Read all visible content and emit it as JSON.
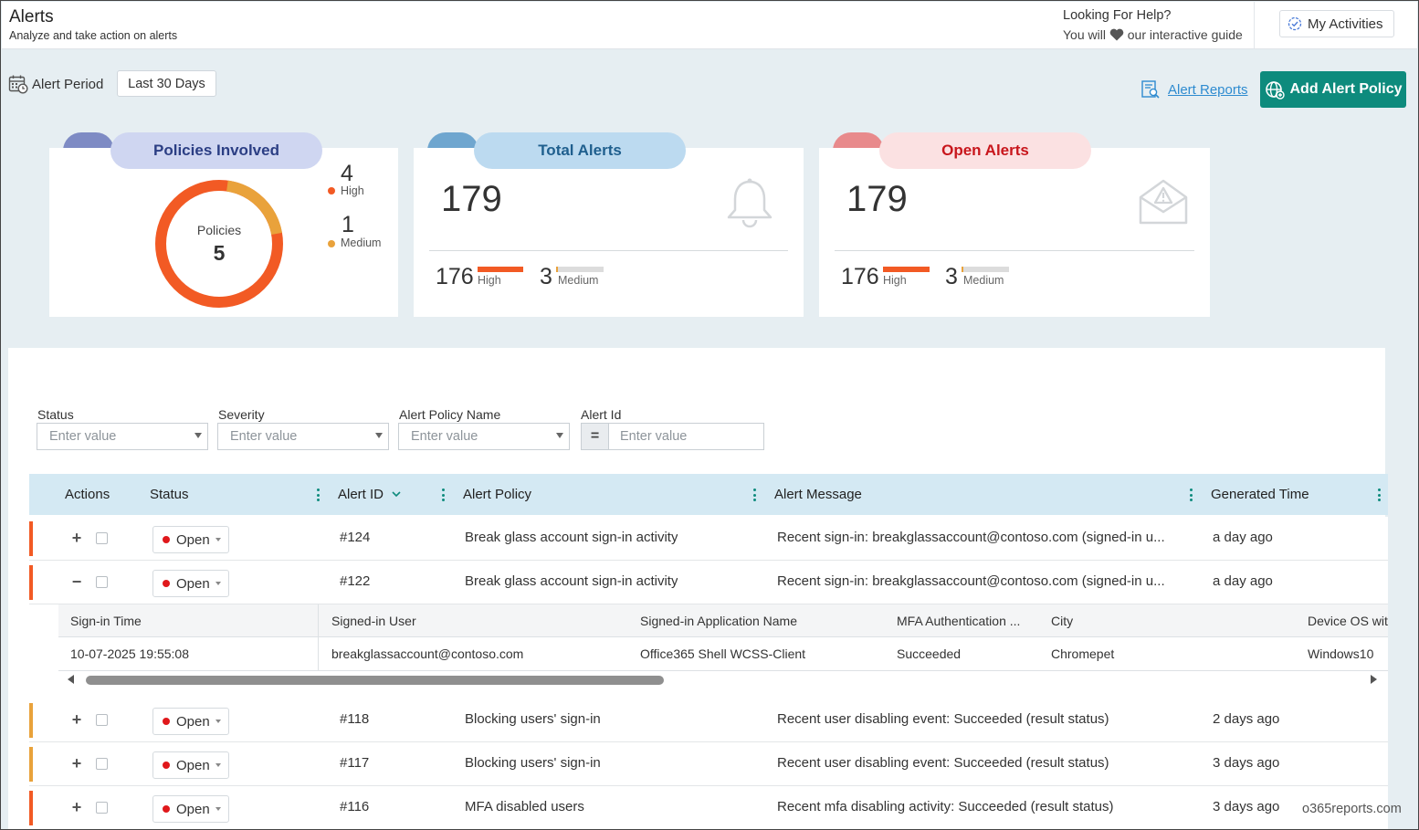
{
  "header": {
    "title": "Alerts",
    "subtitle": "Analyze and take action on alerts",
    "help_title": "Looking For Help?",
    "help_prefix": "You will",
    "help_suffix": "our interactive guide",
    "my_activities": "My Activities"
  },
  "toolbar": {
    "period_label": "Alert Period",
    "period_value": "Last 30 Days",
    "reports_link": "Alert Reports",
    "add_policy": "Add Alert Policy"
  },
  "cards": {
    "policies": {
      "title": "Policies Involved",
      "donut_label": "Policies",
      "donut_value": "5",
      "high_count": "4",
      "high_label": "High",
      "medium_count": "1",
      "medium_label": "Medium",
      "high_fraction": 0.8
    },
    "total": {
      "title": "Total Alerts",
      "value": "179",
      "high_count": "176",
      "high_label": "High",
      "medium_count": "3",
      "medium_label": "Medium"
    },
    "open": {
      "title": "Open Alerts",
      "value": "179",
      "high_count": "176",
      "high_label": "High",
      "medium_count": "3",
      "medium_label": "Medium"
    }
  },
  "filters": {
    "status_label": "Status",
    "severity_label": "Severity",
    "policy_label": "Alert Policy Name",
    "id_label": "Alert Id",
    "placeholder": "Enter value",
    "eq": "="
  },
  "table": {
    "headers": {
      "actions": "Actions",
      "status": "Status",
      "alert_id": "Alert ID",
      "policy": "Alert Policy",
      "message": "Alert Message",
      "time": "Generated Time"
    },
    "rows": [
      {
        "expander": "+",
        "status": "Open",
        "id": "#124",
        "policy": "Break glass account sign-in activity",
        "message": "Recent sign-in: breakglassaccount@contoso.com (signed-in u...",
        "time": "a day ago"
      },
      {
        "expander": "−",
        "status": "Open",
        "id": "#122",
        "policy": "Break glass account sign-in activity",
        "message": "Recent sign-in: breakglassaccount@contoso.com (signed-in u...",
        "time": "a day ago"
      },
      {
        "expander": "+",
        "status": "Open",
        "id": "#118",
        "policy": "Blocking users' sign-in",
        "message": "Recent user disabling event: Succeeded (result status)",
        "time": "2 days ago"
      },
      {
        "expander": "+",
        "status": "Open",
        "id": "#117",
        "policy": "Blocking users' sign-in",
        "message": "Recent user disabling event: Succeeded (result status)",
        "time": "3 days ago"
      },
      {
        "expander": "+",
        "status": "Open",
        "id": "#116",
        "policy": "MFA disabled users",
        "message": "Recent mfa disabling activity: Succeeded (result status)",
        "time": "3 days ago"
      }
    ]
  },
  "detail": {
    "headers": {
      "signin_time": "Sign-in Time",
      "user": "Signed-in User",
      "app": "Signed-in Application Name",
      "mfa": "MFA Authentication ...",
      "city": "City",
      "os": "Device OS with"
    },
    "values": {
      "signin_time": "10-07-2025 19:55:08",
      "user": "breakglassaccount@contoso.com",
      "app": "Office365 Shell WCSS-Client",
      "mfa": "Succeeded",
      "city": "Chromepet",
      "os": "Windows10"
    }
  },
  "watermark": "o365reports.com",
  "colors": {
    "accent": "#0e8b7d",
    "high": "#f25a24",
    "medium": "#e9a23b",
    "link": "#2e8bd0",
    "open_dot": "#e0181b"
  }
}
